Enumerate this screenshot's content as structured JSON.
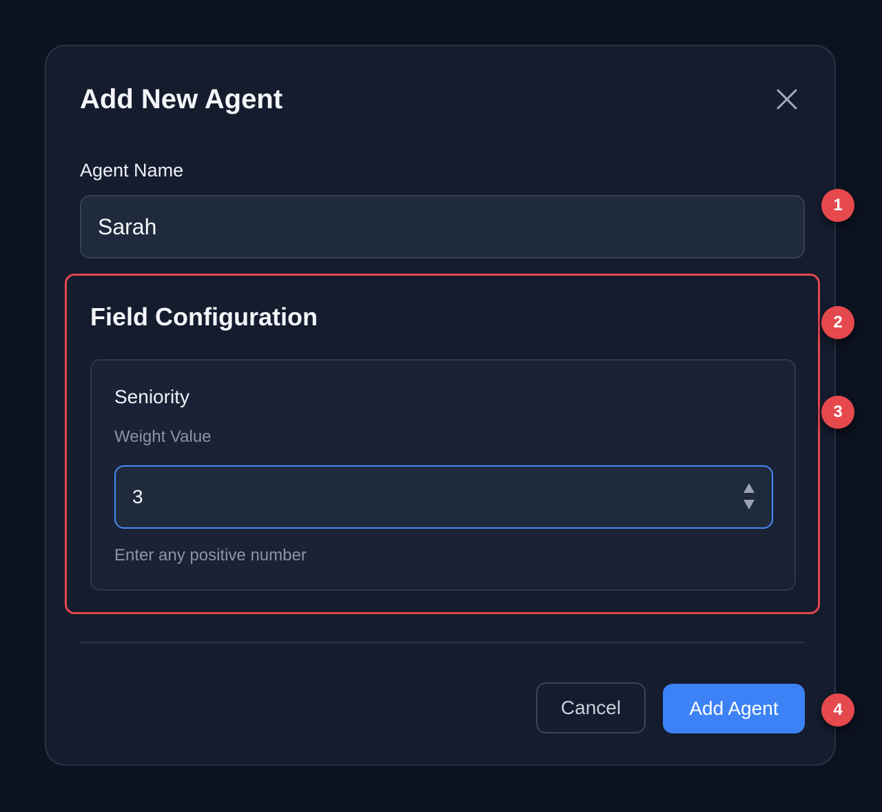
{
  "modal": {
    "title": "Add New Agent",
    "close_icon": "close-icon"
  },
  "agent_name": {
    "label": "Agent Name",
    "value": "Sarah"
  },
  "field_configuration": {
    "title": "Field Configuration",
    "fields": [
      {
        "name": "Seniority",
        "weight_label": "Weight Value",
        "weight_value": "3",
        "hint": "Enter any positive number",
        "stepper_icon": "number-stepper-icon"
      }
    ]
  },
  "footer": {
    "cancel_label": "Cancel",
    "submit_label": "Add Agent"
  },
  "badges": [
    "1",
    "2",
    "3",
    "4"
  ],
  "colors": {
    "background": "#0c1220",
    "modal": "#141c2e",
    "accent": "#3c82f6",
    "highlight": "#e5484d"
  }
}
